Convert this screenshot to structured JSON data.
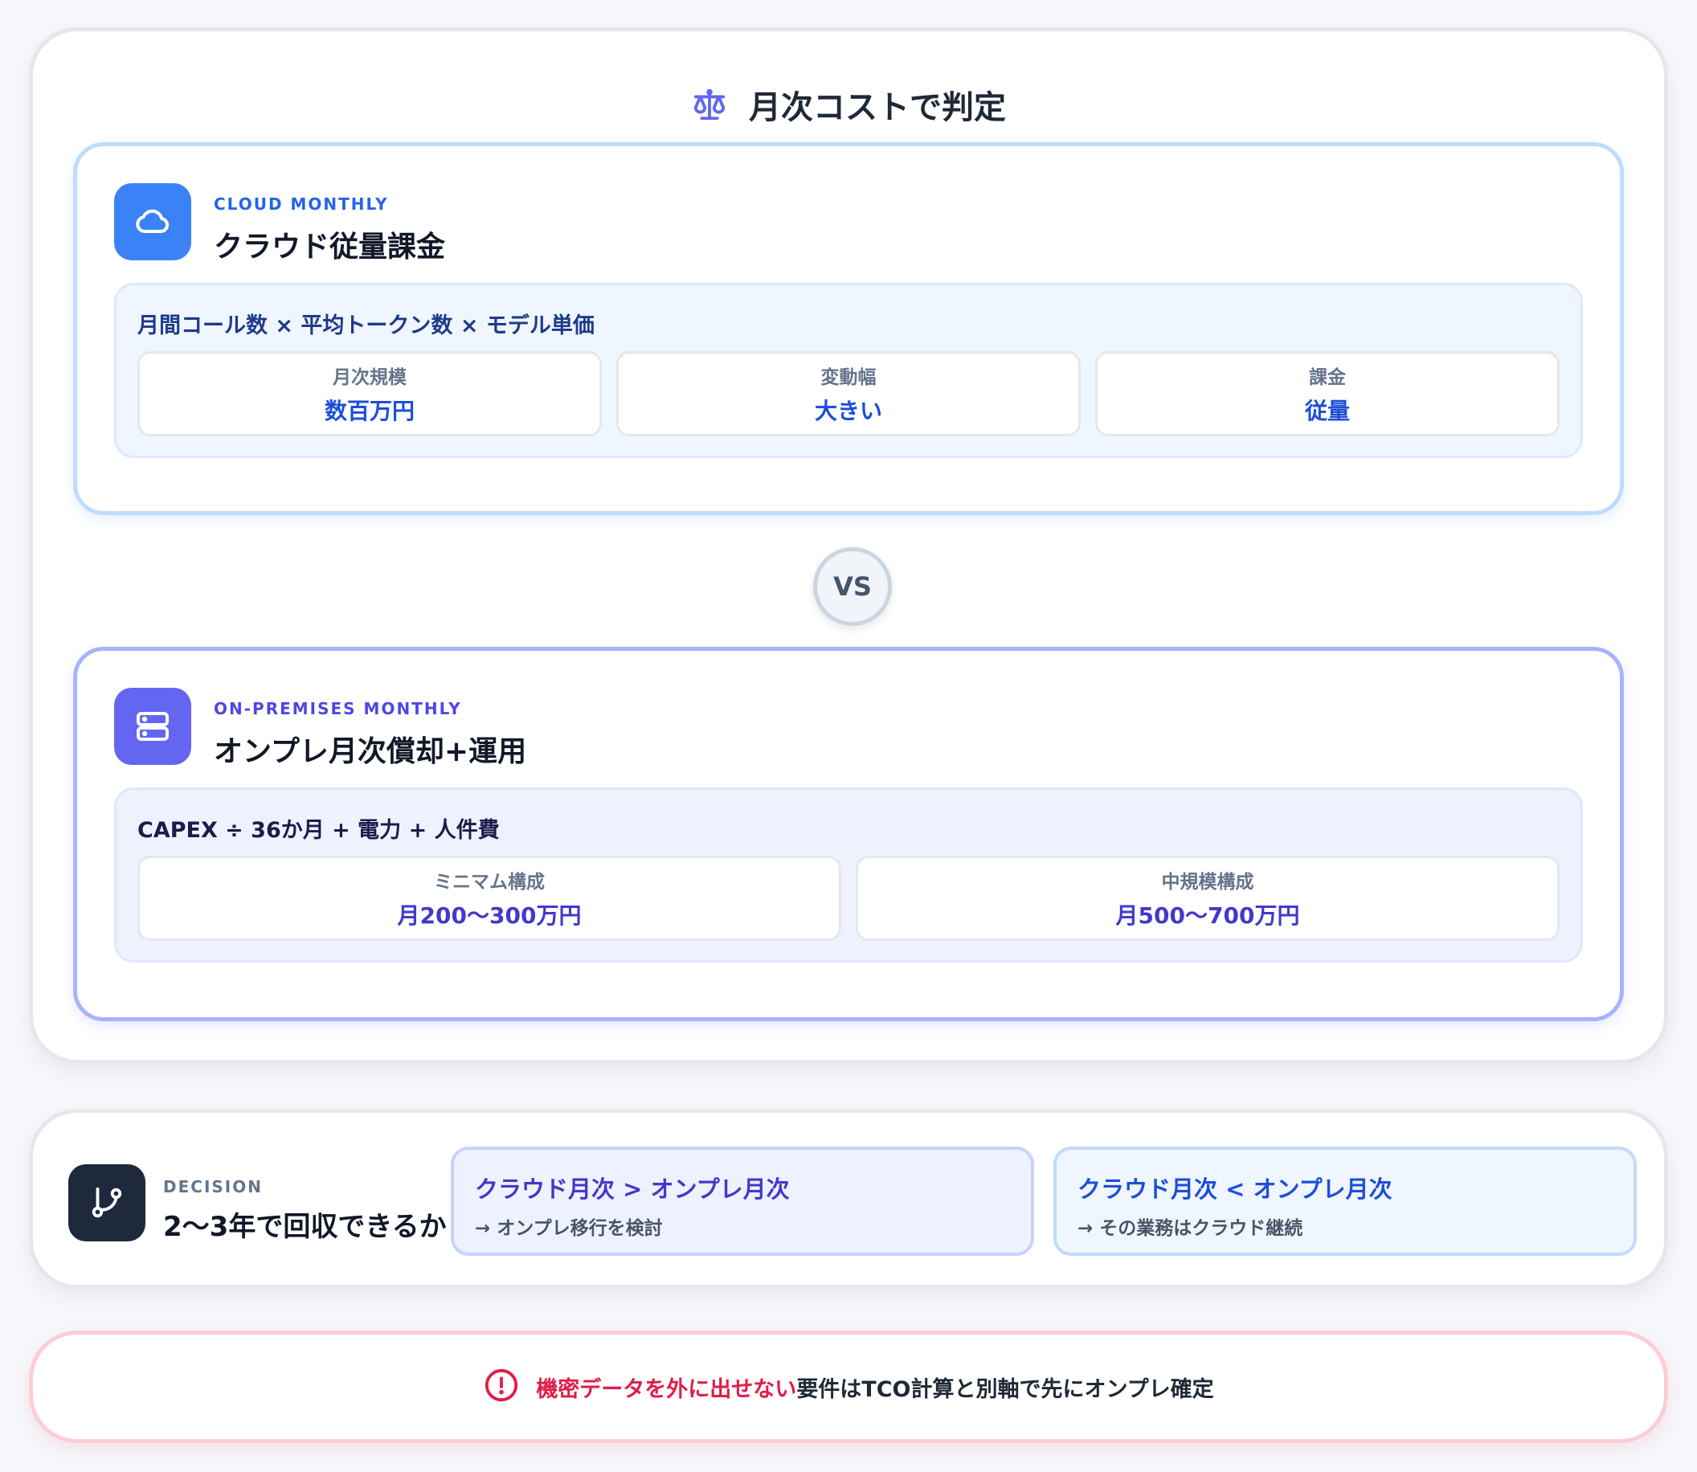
{
  "header": {
    "title": "月次コストで判定",
    "icon": "scale-icon"
  },
  "cloud": {
    "icon": "cloud-icon",
    "eyebrow": "CLOUD MONTHLY",
    "title": "クラウド従量課金",
    "formula": "月間コール数 × 平均トークン数 × モデル単価",
    "stats": [
      {
        "label": "月次規模",
        "value": "数百万円"
      },
      {
        "label": "変動幅",
        "value": "大きい"
      },
      {
        "label": "課金",
        "value": "従量"
      }
    ]
  },
  "vs_label": "VS",
  "onprem": {
    "icon": "server-icon",
    "eyebrow": "ON-PREMISES MONTHLY",
    "title": "オンプレ月次償却+運用",
    "formula": "CAPEX ÷ 36か月 + 電力 + 人件費",
    "stats": [
      {
        "label": "ミニマム構成",
        "value": "月200〜300万円"
      },
      {
        "label": "中規模構成",
        "value": "月500〜700万円"
      }
    ]
  },
  "decision": {
    "icon": "branch-icon",
    "eyebrow": "DECISION",
    "title": "2〜3年で回収できるか",
    "options": [
      {
        "title": "クラウド月次 > オンプレ月次",
        "sub": "→ オンプレ移行を検討"
      },
      {
        "title": "クラウド月次 < オンプレ月次",
        "sub": "→ その業務はクラウド継続"
      }
    ]
  },
  "alert": {
    "icon": "alert-icon",
    "highlight": "機密データを外に出せない",
    "text": "要件はTCO計算と別軸で先にオンプレ確定"
  },
  "colors": {
    "cloud_accent": "#3b82f6",
    "onprem_accent": "#6366f1",
    "decision_dark": "#1e293b",
    "alert_red": "#e11d48"
  }
}
